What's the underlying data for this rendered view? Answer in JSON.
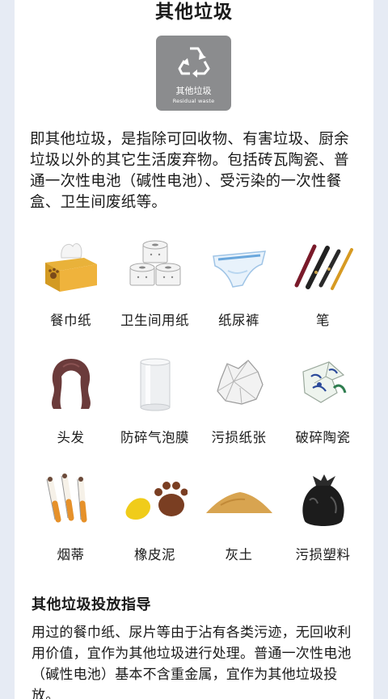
{
  "header": {
    "title": "其他垃圾"
  },
  "badge": {
    "icon": "recycle-arrows-icon",
    "label_zh": "其他垃圾",
    "label_en": "Residual waste",
    "color": "#8b8c8e"
  },
  "intro": "即其他垃圾，是指除可回收物、有害垃圾、厨余垃圾以外的其它生活废弃物。包括砖瓦陶瓷、普通一次性电池（碱性电池）、受污染的一次性餐盒、卫生间废纸等。",
  "items": [
    {
      "label": "餐巾纸",
      "icon": "tissue-box-icon"
    },
    {
      "label": "卫生间用纸",
      "icon": "toilet-paper-icon"
    },
    {
      "label": "纸尿裤",
      "icon": "diaper-icon"
    },
    {
      "label": "笔",
      "icon": "pens-icon"
    },
    {
      "label": "头发",
      "icon": "hair-icon"
    },
    {
      "label": "防碎气泡膜",
      "icon": "bubble-wrap-roll-icon"
    },
    {
      "label": "污损纸张",
      "icon": "crumpled-paper-icon"
    },
    {
      "label": "破碎陶瓷",
      "icon": "broken-ceramic-icon"
    },
    {
      "label": "烟蒂",
      "icon": "cigarette-butts-icon"
    },
    {
      "label": "橡皮泥",
      "icon": "plasticine-icon"
    },
    {
      "label": "灰土",
      "icon": "dust-pile-icon"
    },
    {
      "label": "污损塑料",
      "icon": "garbage-bag-icon"
    }
  ],
  "guide": {
    "title": "其他垃圾投放指导",
    "text": "用过的餐巾纸、尿片等由于沾有各类污迹，无回收利用价值，宜作为其他垃圾进行处理。普通一次性电池（碱性电池）基本不含重金属，宜作为其他垃圾投放。"
  }
}
